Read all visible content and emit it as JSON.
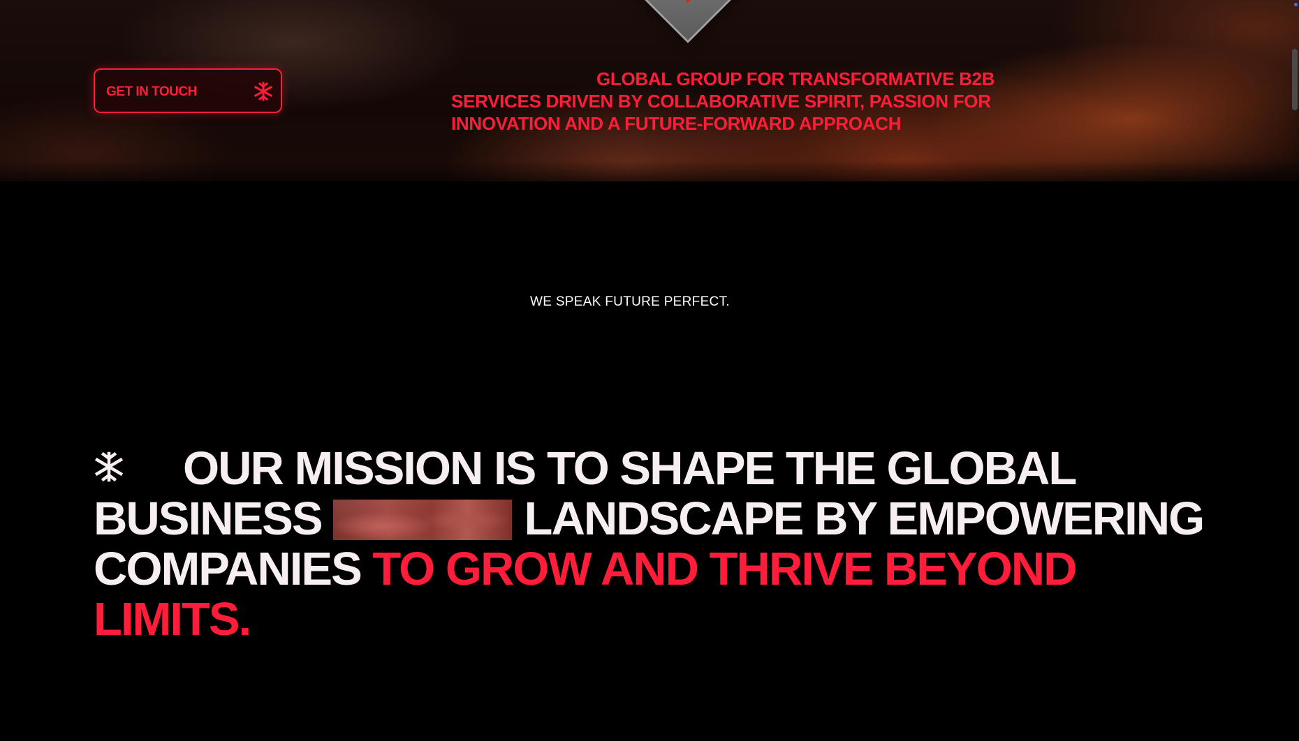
{
  "hero": {
    "button_label": "GET IN TOUCH",
    "button_icon": "snowflake-logo-icon",
    "tagline_lines": [
      "GLOBAL GROUP FOR TRANSFORMATIVE B2B",
      "SERVICES DRIVEN BY COLLABORATIVE SPIRIT, PASSION FOR",
      "INNOVATION AND A FUTURE-FORWARD APPROACH"
    ]
  },
  "slogan": "WE SPEAK FUTURE PERFECT.",
  "mission": {
    "icon": "snowflake-logo-icon",
    "line1": "OUR MISSION IS TO SHAPE THE GLOBAL",
    "line2_start": "BUSINESS",
    "line2_end": "LANDSCAPE BY EMPOWERING",
    "line3_white": "COMPANIES",
    "line3_red": "TO GROW AND THRIVE BEYOND",
    "line4_red": "LIMITS."
  },
  "colors": {
    "accent": "#ff1d3a",
    "background": "#000000",
    "text": "#f6eef0"
  }
}
